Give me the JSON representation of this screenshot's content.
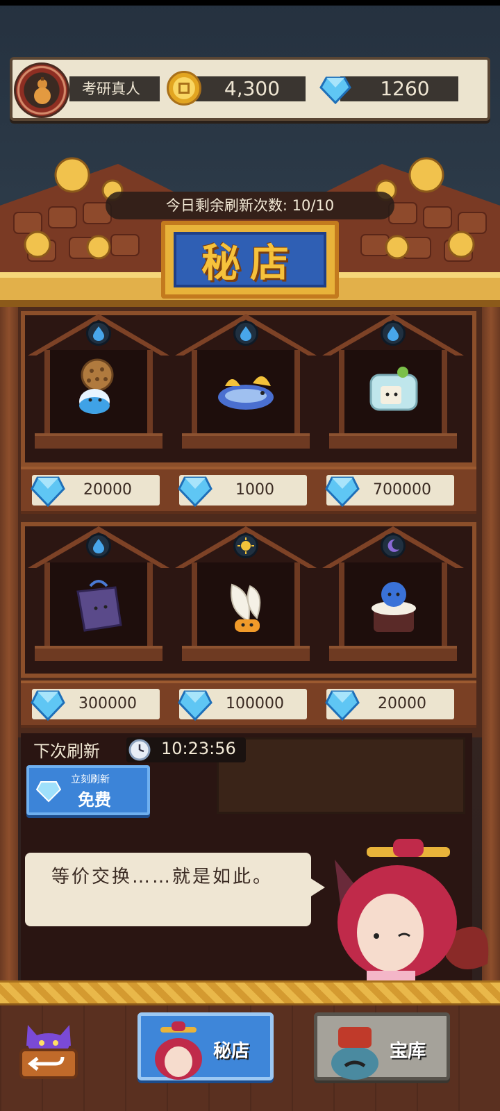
{
  "player": {
    "name": "考研真人",
    "coins": "4,300",
    "gems": "1260"
  },
  "shop": {
    "refresh_count_label": "今日剩余刷新次数: 10/10",
    "title": "秘店",
    "items": [
      {
        "element": "water-drop-icon",
        "art": "puffer-creature",
        "price": "20000"
      },
      {
        "element": "water-drop-icon",
        "art": "sea-slug-creature",
        "price": "1000"
      },
      {
        "element": "water-drop-icon",
        "art": "cube-creature",
        "price": "700000"
      },
      {
        "element": "water-drop-icon",
        "art": "bag-creature",
        "price": "300000"
      },
      {
        "element": "sun-icon",
        "art": "feather-creature",
        "price": "100000"
      },
      {
        "element": "moon-icon",
        "art": "cake-creature",
        "price": "20000"
      }
    ],
    "next_refresh_label": "下次刷新",
    "timer": "10:23:56",
    "refresh_button": {
      "small_label": "立刻刷新",
      "label": "免费"
    }
  },
  "dialog": {
    "text": "等价交换……就是如此。"
  },
  "nav": {
    "shop_tab": "秘店",
    "vault_tab": "宝库"
  },
  "colors": {
    "accent_blue": "#3e86d9",
    "gold": "#e8b33a",
    "wood": "#6e3a22"
  }
}
